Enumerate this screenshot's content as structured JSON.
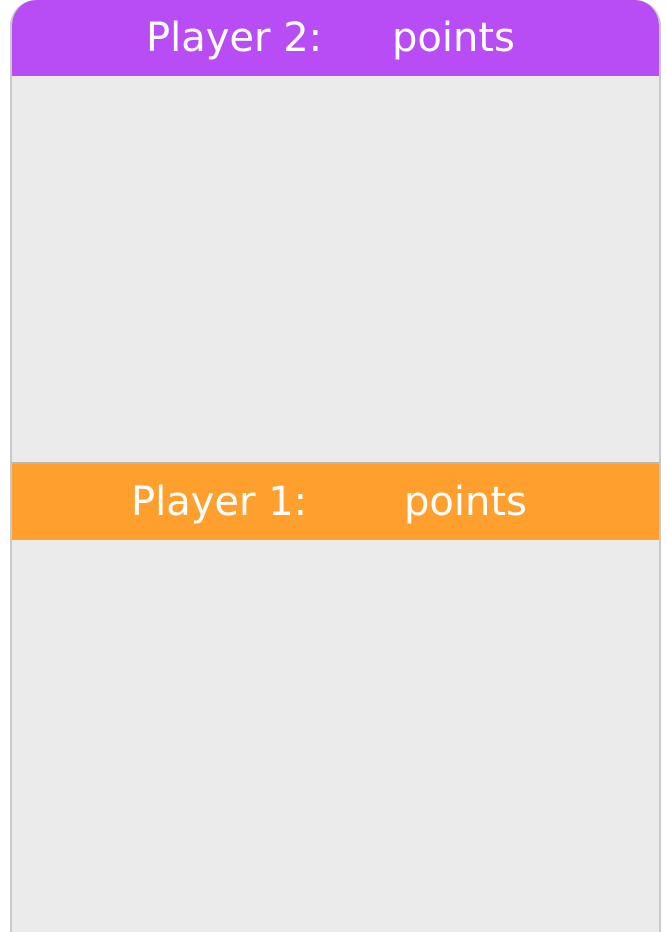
{
  "player2": {
    "label": "Player 2:",
    "points_label": "points",
    "color": "#b84cf5"
  },
  "player1": {
    "label": "Player 1:",
    "points_label": "points",
    "color": "#ff9f2e"
  },
  "board": {
    "background_color": "#ebebeb"
  }
}
